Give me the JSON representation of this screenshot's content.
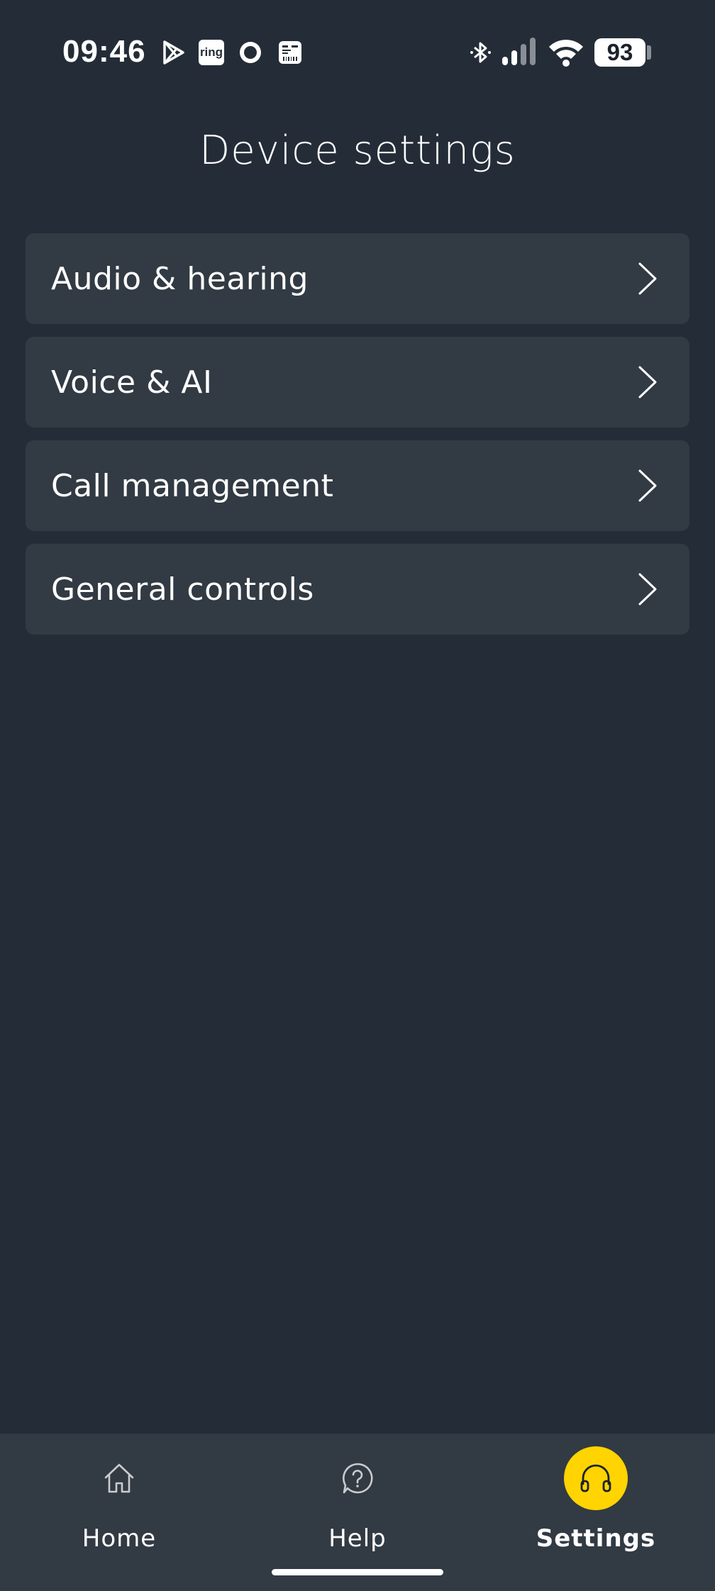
{
  "status_bar": {
    "time": "09:46",
    "ring_label": "ring",
    "battery": "93",
    "icons": [
      "play-store-icon",
      "ring-app-icon",
      "circle-app-icon",
      "wallet-app-icon",
      "bluetooth-icon",
      "signal-icon",
      "wifi-icon",
      "battery-icon"
    ]
  },
  "header": {
    "title": "Device settings"
  },
  "menu": {
    "items": [
      {
        "label": "Audio & hearing"
      },
      {
        "label": "Voice & AI"
      },
      {
        "label": "Call management"
      },
      {
        "label": "General controls"
      }
    ]
  },
  "bottom_nav": {
    "items": [
      {
        "label": "Home",
        "icon": "home-icon",
        "active": false
      },
      {
        "label": "Help",
        "icon": "help-icon",
        "active": false
      },
      {
        "label": "Settings",
        "icon": "headphones-icon",
        "active": true
      }
    ]
  },
  "colors": {
    "background": "#242d37",
    "card": "#323a43",
    "accent": "#ffd400",
    "text": "#ffffff"
  }
}
